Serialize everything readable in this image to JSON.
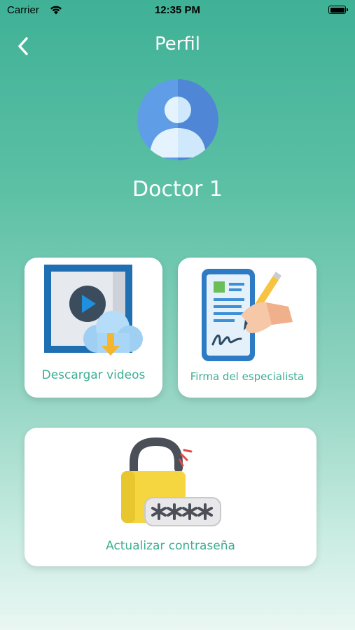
{
  "status_bar": {
    "carrier": "Carrier",
    "time": "12:35 PM",
    "wifi_icon": "wifi-icon",
    "battery_icon": "battery-icon"
  },
  "header": {
    "title": "Perfil",
    "back_icon": "chevron-left-icon"
  },
  "profile": {
    "avatar_icon": "user-avatar-icon",
    "name": "Doctor 1"
  },
  "options": [
    {
      "label": "Descargar videos",
      "icon": "video-download-icon"
    },
    {
      "label": "Firma del especialista",
      "icon": "signature-icon"
    },
    {
      "label": "Actualizar contraseña",
      "icon": "padlock-password-icon"
    }
  ],
  "colors": {
    "accent_text": "#3fae93",
    "background_top": "#3fb196",
    "background_bottom": "#eaf7f3"
  }
}
